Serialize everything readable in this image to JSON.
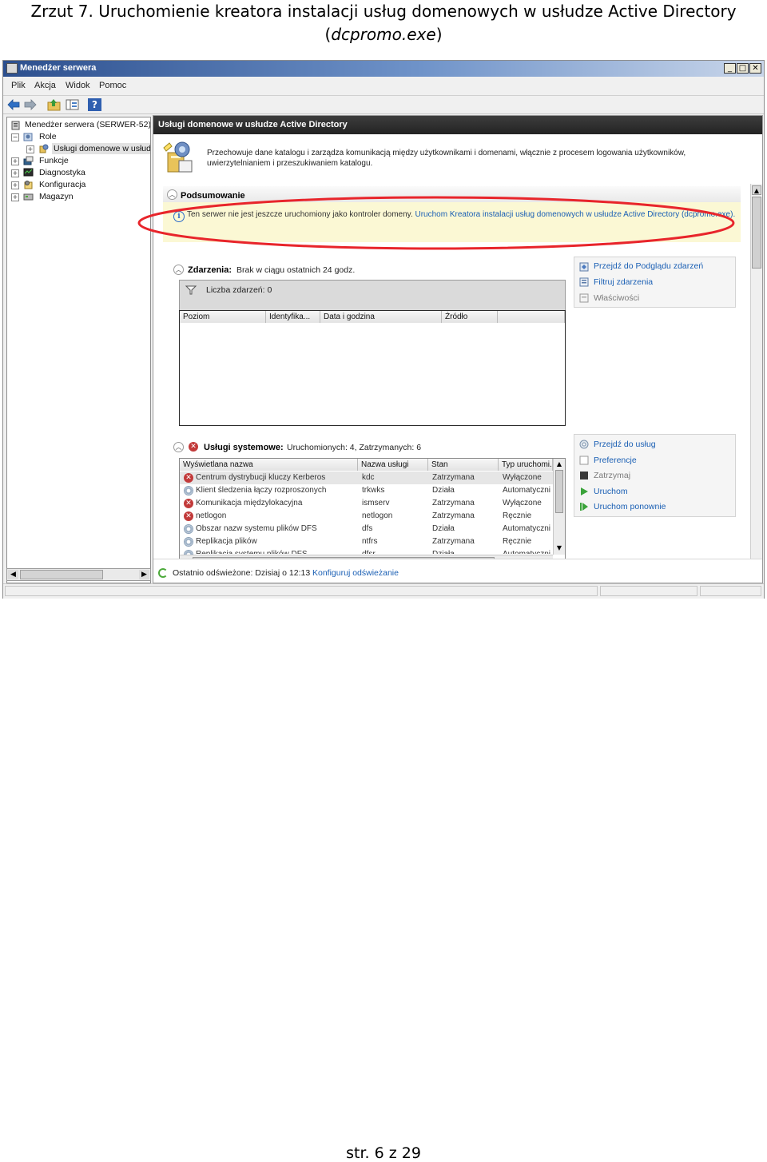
{
  "document": {
    "caption_line1": "Zrzut 7.  Uruchomienie kreatora instalacji usług domenowych w usłudze Active Directory",
    "caption_paren_open": "(",
    "caption_exe": "dcpromo.exe",
    "caption_paren_close": ")",
    "page_number": "str. 6 z 29"
  },
  "window": {
    "title": "Menedżer serwera",
    "controls": {
      "minimize": "_",
      "maximize": "□",
      "close": "✕"
    },
    "menu": [
      "Plik",
      "Akcja",
      "Widok",
      "Pomoc"
    ],
    "toolbar_icons": [
      "back-arrow-icon",
      "forward-arrow-icon",
      "up-folder-icon",
      "show-hide-tree-icon",
      "help-icon"
    ]
  },
  "tree": {
    "root": "Menedżer serwera (SERWER-52)",
    "items": [
      {
        "label": "Role",
        "expander": "−"
      },
      {
        "label": "Usługi domenowe w usłudze",
        "expander": "+"
      },
      {
        "label": "Funkcje",
        "expander": "+"
      },
      {
        "label": "Diagnostyka",
        "expander": "+"
      },
      {
        "label": "Konfiguracja",
        "expander": "+"
      },
      {
        "label": "Magazyn",
        "expander": "+"
      }
    ]
  },
  "content": {
    "header": "Usługi domenowe w usłudze Active Directory",
    "description": "Przechowuje dane katalogu i zarządza komunikacją między użytkownikami i domenami, włącznie z procesem logowania użytkowników, uwierzytelnianiem i przeszukiwaniem katalogu.",
    "summary": {
      "title": "Podsumowanie",
      "info_text": "Ten serwer nie jest jeszcze uruchomiony jako kontroler domeny. ",
      "info_link": "Uruchom Kreatora instalacji usług domenowych w usłudze Active Directory (dcpromo.exe)."
    },
    "events": {
      "title": "Zdarzenia:",
      "value": "Brak w ciągu ostatnich 24 godz.",
      "count_label": "Liczba zdarzeń: 0",
      "columns": [
        "Poziom",
        "Identyfika...",
        "Data i godzina",
        "Źródło"
      ],
      "tasks": [
        {
          "label": "Przejdź do Podglądu zdarzeń",
          "enabled": true,
          "icon": "event-viewer-icon"
        },
        {
          "label": "Filtruj zdarzenia",
          "enabled": true,
          "icon": "filter-icon"
        },
        {
          "label": "Właściwości",
          "enabled": false,
          "icon": "properties-icon"
        }
      ]
    },
    "services": {
      "title": "Usługi systemowe:",
      "value": "Uruchomionych: 4, Zatrzymanych: 6",
      "columns": [
        "Wyświetlana nazwa",
        "Nazwa usługi",
        "Stan",
        "Typ uruchomi..."
      ],
      "rows": [
        [
          "Centrum dystrybucji kluczy Kerberos",
          "kdc",
          "Zatrzymana",
          "Wyłączone"
        ],
        [
          "Klient śledzenia łączy rozproszonych",
          "trkwks",
          "Działa",
          "Automatyczni"
        ],
        [
          "Komunikacja międzylokacyjna",
          "ismserv",
          "Zatrzymana",
          "Wyłączone"
        ],
        [
          "netlogon",
          "netlogon",
          "Zatrzymana",
          "Ręcznie"
        ],
        [
          "Obszar nazw systemu plików DFS",
          "dfs",
          "Działa",
          "Automatyczni"
        ],
        [
          "Replikacja plików",
          "ntfrs",
          "Zatrzymana",
          "Ręcznie"
        ],
        [
          "Replikacja systemu plików DFS",
          "dfsr",
          "Działa",
          "Automatyczni"
        ]
      ],
      "tasks": [
        {
          "label": "Przejdź do usług",
          "enabled": true,
          "icon": "services-icon"
        },
        {
          "label": "Preferencje",
          "enabled": true,
          "icon": "preferences-icon"
        },
        {
          "label": "Zatrzymaj",
          "enabled": false,
          "icon": "stop-icon"
        },
        {
          "label": "Uruchom",
          "enabled": true,
          "icon": "start-icon"
        },
        {
          "label": "Uruchom ponownie",
          "enabled": true,
          "icon": "restart-icon"
        }
      ]
    },
    "footer": {
      "refreshed": "Ostatnio odświeżone: Dzisiaj o 12:13",
      "configure_link": "Konfiguruj odświeżanie"
    }
  },
  "colors": {
    "titlebar": "#2c4f8e",
    "header": "#2f2f2f",
    "link": "#1a5fb4",
    "info_band": "#fbf8d4",
    "highlight_ellipse": "#e8252b",
    "stopped": "#c23a3a",
    "start_green": "#3aa33a"
  }
}
